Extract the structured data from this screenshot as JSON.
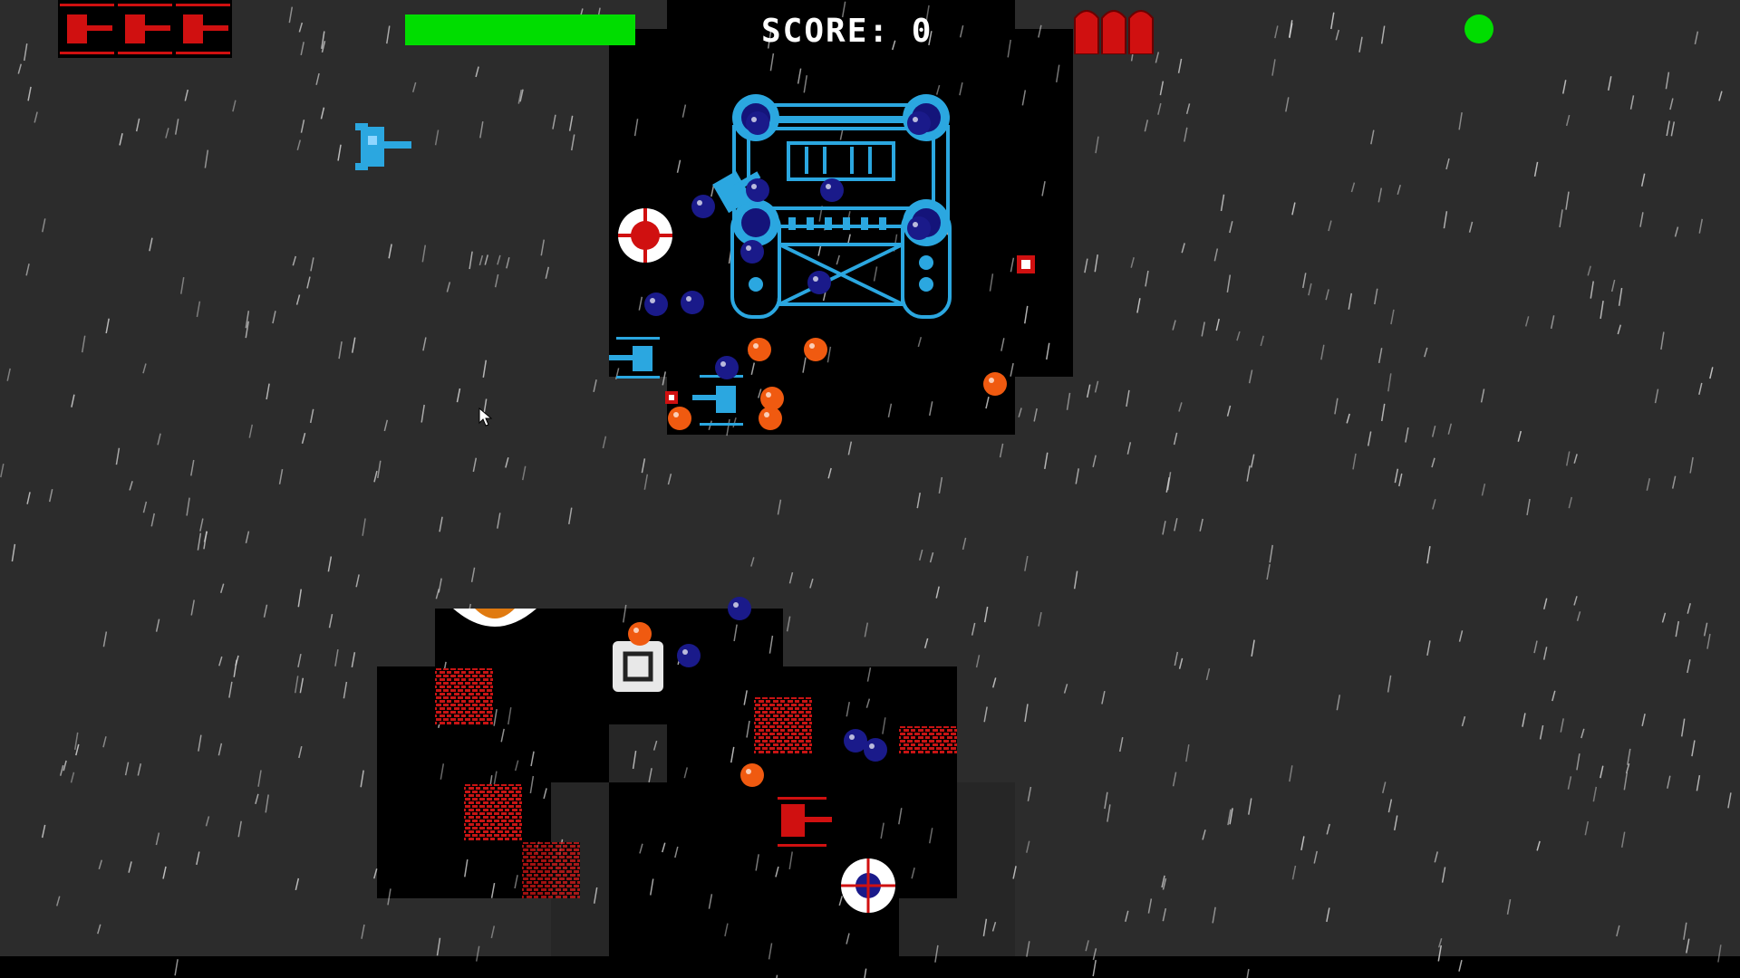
{
  "hud": {
    "score_text": "SCORE: 0",
    "health_fraction": 1.0,
    "lives": 3,
    "ammo_shells": 3,
    "status": "online"
  },
  "colors": {
    "background": "#2c2c2c",
    "fog": "#000000",
    "health": "#00dd00",
    "status_dot": "#00dd00",
    "player_blue": "#2ba7e0",
    "enemy_red": "#d01010",
    "orb_blue": "#1a1a8a",
    "orb_orange": "#f05a10",
    "brick_red": "#c81414"
  },
  "icons": {
    "lives": "red-tank-icon",
    "ammo": "shell-icon",
    "status": "online-dot-icon",
    "cursor": "mouse-pointer-icon"
  }
}
